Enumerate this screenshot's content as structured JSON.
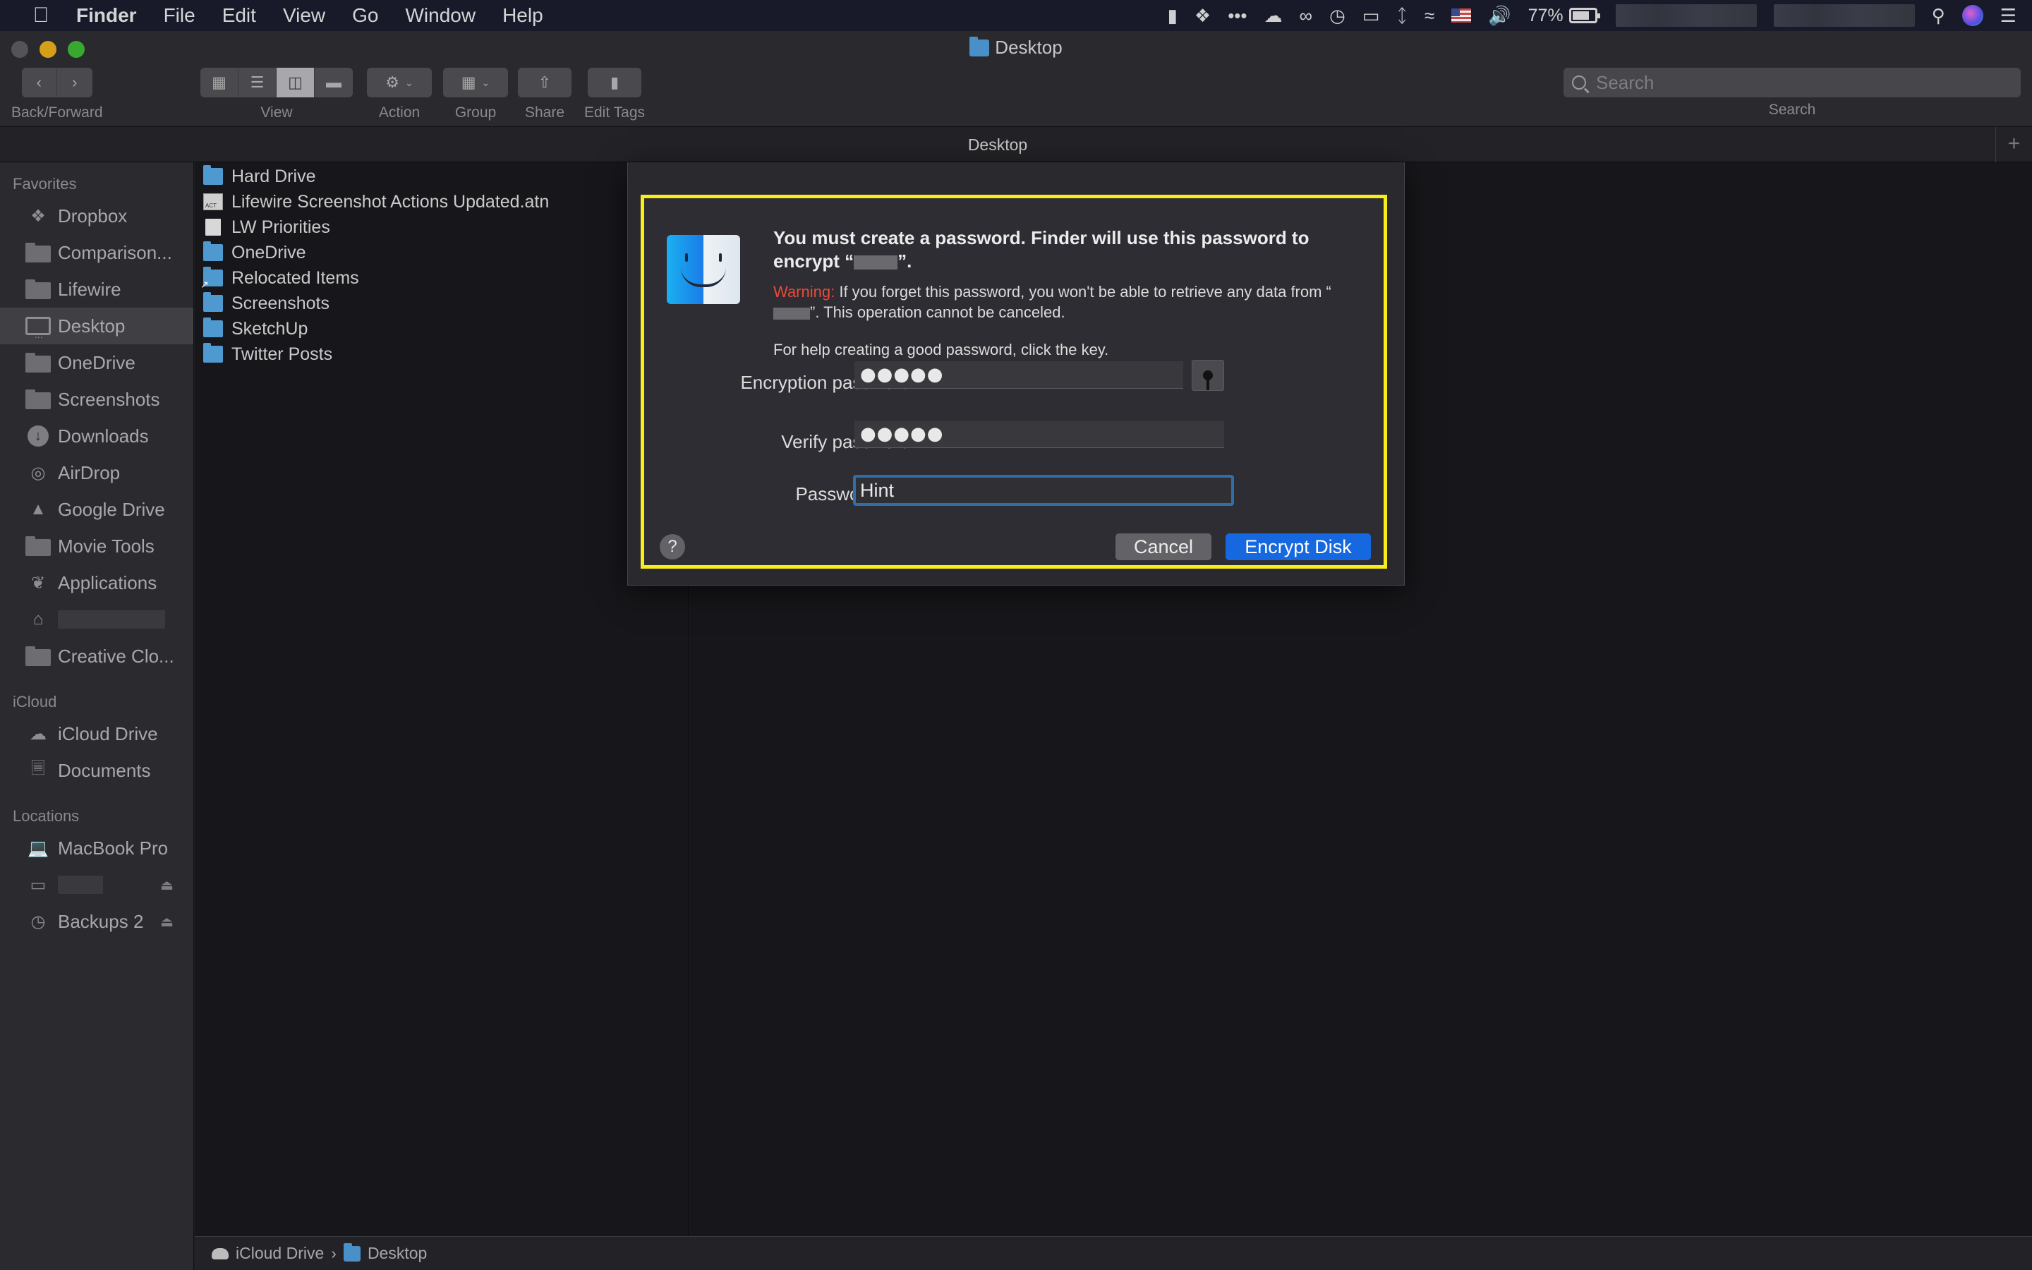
{
  "menubar": {
    "app_name": "Finder",
    "items": [
      "File",
      "Edit",
      "View",
      "Go",
      "Window",
      "Help"
    ],
    "status": {
      "battery_percent": "77%",
      "battery_level": 0.77,
      "icons": [
        "notification-icon",
        "dropbox-icon",
        "more-icon",
        "cloud-upload-icon",
        "creative-cloud-icon",
        "time-machine-icon",
        "airplay-icon",
        "bluetooth-icon",
        "wifi-icon",
        "us-flag-icon",
        "volume-icon",
        "battery-icon",
        "spotlight-icon",
        "siri-icon",
        "notification-center-icon"
      ]
    }
  },
  "window": {
    "title": "Desktop",
    "toolbar": {
      "back_forward_label": "Back/Forward",
      "view_label": "View",
      "action_label": "Action",
      "group_label": "Group",
      "share_label": "Share",
      "edit_tags_label": "Edit Tags",
      "active_view": "columns"
    },
    "search": {
      "placeholder": "Search",
      "label": "Search"
    },
    "tab_title": "Desktop",
    "add_tab": "+"
  },
  "sidebar": {
    "favorites_header": "Favorites",
    "favorites": [
      {
        "label": "Dropbox",
        "icon": "dropbox-icon"
      },
      {
        "label": "Comparison...",
        "icon": "folder-icon"
      },
      {
        "label": "Lifewire",
        "icon": "folder-icon"
      },
      {
        "label": "Desktop",
        "icon": "desktop-icon",
        "selected": true
      },
      {
        "label": "OneDrive",
        "icon": "folder-icon"
      },
      {
        "label": "Screenshots",
        "icon": "folder-icon"
      },
      {
        "label": "Downloads",
        "icon": "downloads-icon"
      },
      {
        "label": "AirDrop",
        "icon": "airdrop-icon"
      },
      {
        "label": "Google Drive",
        "icon": "google-drive-icon"
      },
      {
        "label": "Movie Tools",
        "icon": "folder-icon"
      },
      {
        "label": "Applications",
        "icon": "applications-icon"
      },
      {
        "label": "",
        "icon": "home-icon",
        "redacted": true
      },
      {
        "label": "Creative Clo...",
        "icon": "folder-icon"
      }
    ],
    "icloud_header": "iCloud",
    "icloud": [
      {
        "label": "iCloud Drive",
        "icon": "cloud-icon"
      },
      {
        "label": "Documents",
        "icon": "documents-icon"
      }
    ],
    "locations_header": "Locations",
    "locations": [
      {
        "label": "MacBook Pro",
        "icon": "laptop-icon"
      },
      {
        "label": "",
        "icon": "external-drive-icon",
        "redacted": true,
        "ejectable": true
      },
      {
        "label": "Backups 2",
        "icon": "time-machine-drive-icon",
        "ejectable": true
      }
    ]
  },
  "files": [
    {
      "name": "Hard Drive",
      "type": "folder"
    },
    {
      "name": "Lifewire Screenshot Actions Updated.atn",
      "type": "atn"
    },
    {
      "name": "LW Priorities",
      "type": "document"
    },
    {
      "name": "OneDrive",
      "type": "folder"
    },
    {
      "name": "Relocated Items",
      "type": "alias"
    },
    {
      "name": "Screenshots",
      "type": "folder"
    },
    {
      "name": "SketchUp",
      "type": "folder"
    },
    {
      "name": "Twitter Posts",
      "type": "folder"
    }
  ],
  "pathbar": {
    "items": [
      "iCloud Drive",
      "Desktop"
    ],
    "separator": "›"
  },
  "dialog": {
    "title_part1": "You must create a password. Finder will use this password to encrypt “",
    "title_part2": "”.",
    "warning_label": "Warning:",
    "warning_part1": " If you forget this password, you won't be able to retrieve any data from “",
    "warning_part2": "”. This operation cannot be canceled.",
    "help_text": "For help creating a good password, click the key.",
    "encryption_label": "Encryption password:",
    "encryption_value": "●●●●●",
    "verify_label": "Verify password:",
    "verify_value": "●●●●●",
    "hint_label": "Password hint:",
    "hint_value": "Hint",
    "help_button": "?",
    "cancel_button": "Cancel",
    "encrypt_button": "Encrypt Disk",
    "accent_color": "#1668e0",
    "highlight_color": "#f7ec1c",
    "warning_color": "#e84b3a"
  }
}
